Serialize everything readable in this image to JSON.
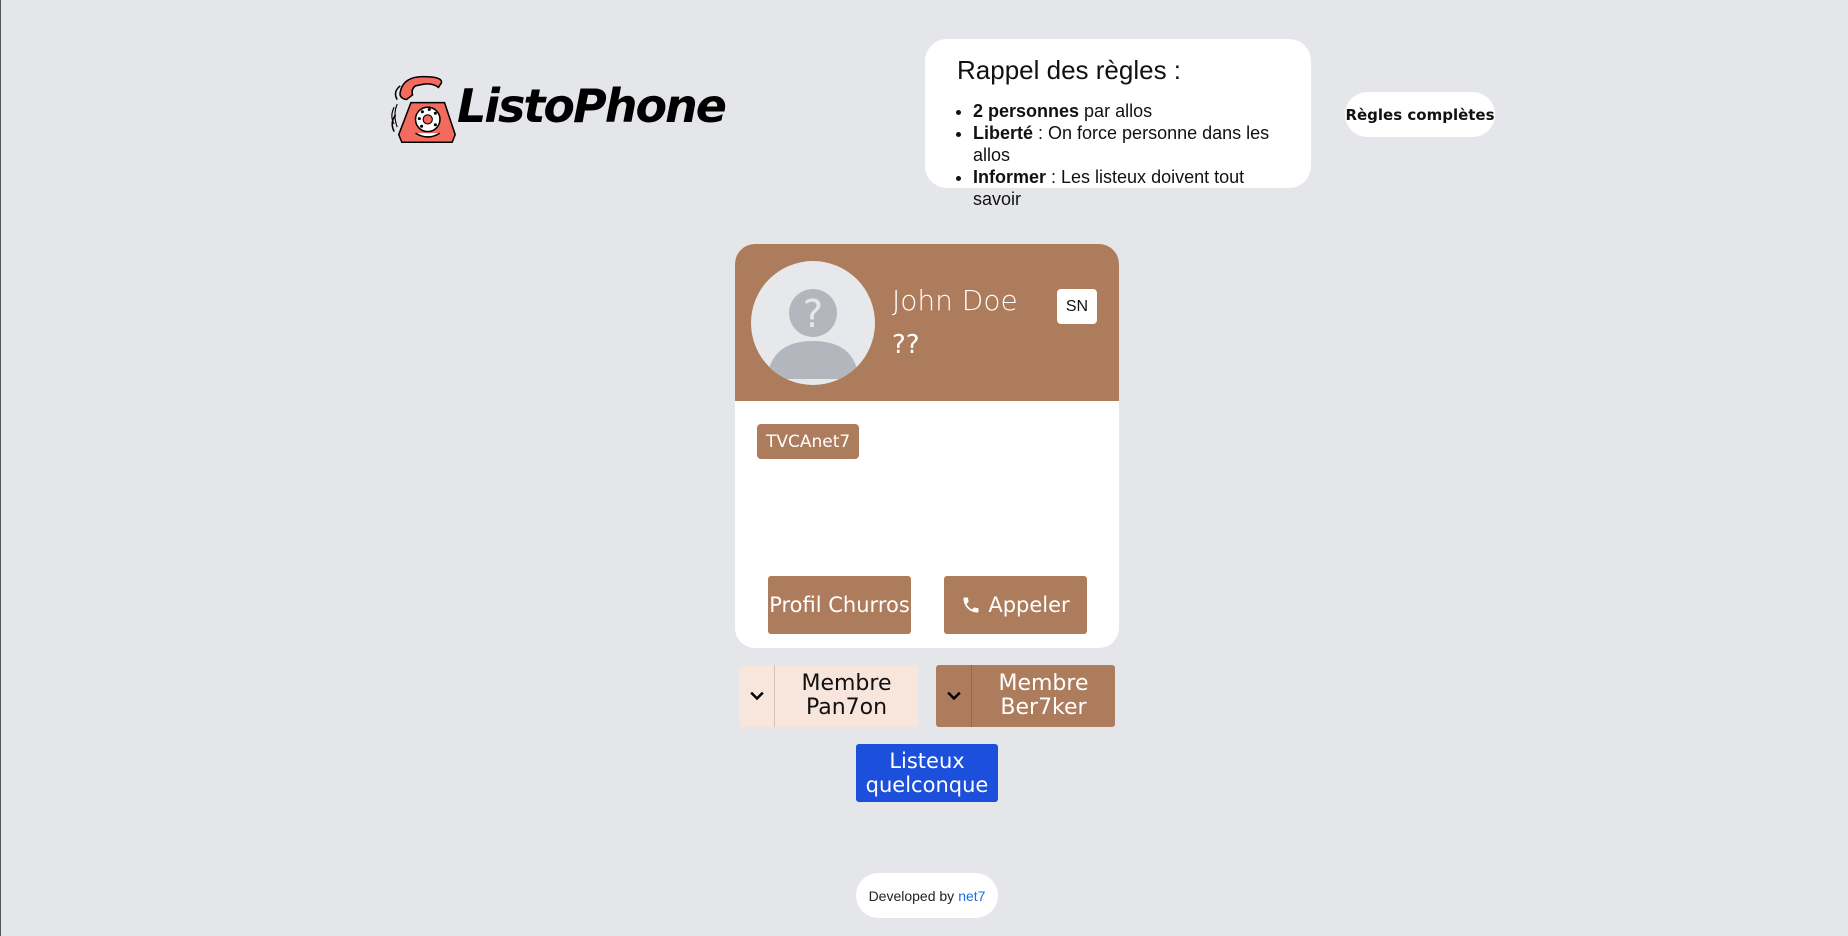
{
  "header": {
    "logo_text": "ListoPhone"
  },
  "rules": {
    "title": "Rappel des règles :",
    "items": [
      {
        "bold": "2 personnes",
        "text": " par allos"
      },
      {
        "bold": "Liberté",
        "text": " : On force personne dans les allos"
      },
      {
        "bold": "Informer",
        "text": " : Les listeux doivent tout savoir"
      }
    ],
    "full_rules_label": "Règles complètes"
  },
  "profile": {
    "name": "John Doe",
    "subtitle": "??",
    "badge": "SN",
    "tag": "TVCAnet7",
    "profile_button": "Profil Churros",
    "call_button": "Appeler",
    "accent_color": "#ad7c5c"
  },
  "members": [
    {
      "label": "Membre Pan7on"
    },
    {
      "label": "Membre Ber7ker"
    }
  ],
  "listeux_button": "Listeux quelconque",
  "footer": {
    "text": "Developed by",
    "link": "net7"
  }
}
